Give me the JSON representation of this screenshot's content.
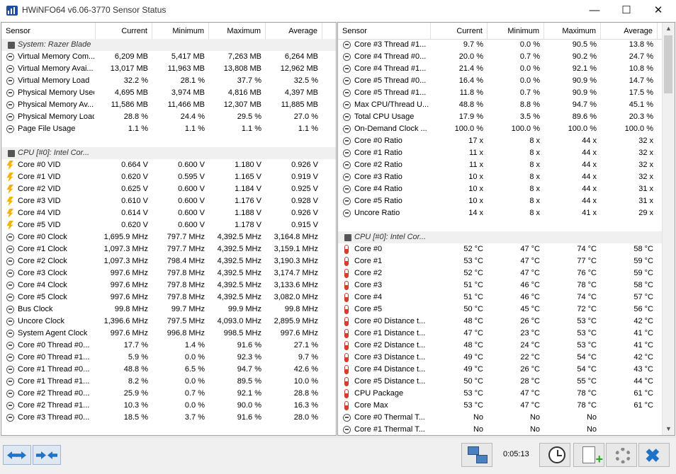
{
  "window": {
    "title": "HWiNFO64 v6.06-3770 Sensor Status",
    "minimize_icon": "minimize-icon",
    "maximize_icon": "maximize-icon",
    "close_icon": "close-icon"
  },
  "columns": [
    "Sensor",
    "Current",
    "Minimum",
    "Maximum",
    "Average"
  ],
  "left_rows": [
    {
      "type": "group",
      "icon": "chip-icon",
      "name": "System: Razer Blade"
    },
    {
      "type": "sensor",
      "icon": "gauge-icon",
      "name": "Virtual Memory Com...",
      "cur": "6,209 MB",
      "min": "5,417 MB",
      "max": "7,263 MB",
      "avg": "6,264 MB"
    },
    {
      "type": "sensor",
      "icon": "gauge-icon",
      "name": "Virtual Memory Avai...",
      "cur": "13,017 MB",
      "min": "11,963 MB",
      "max": "13,808 MB",
      "avg": "12,962 MB"
    },
    {
      "type": "sensor",
      "icon": "gauge-icon",
      "name": "Virtual Memory Load",
      "cur": "32.2 %",
      "min": "28.1 %",
      "max": "37.7 %",
      "avg": "32.5 %"
    },
    {
      "type": "sensor",
      "icon": "gauge-icon",
      "name": "Physical Memory Used",
      "cur": "4,695 MB",
      "min": "3,974 MB",
      "max": "4,816 MB",
      "avg": "4,397 MB"
    },
    {
      "type": "sensor",
      "icon": "gauge-icon",
      "name": "Physical Memory Av...",
      "cur": "11,586 MB",
      "min": "11,466 MB",
      "max": "12,307 MB",
      "avg": "11,885 MB"
    },
    {
      "type": "sensor",
      "icon": "gauge-icon",
      "name": "Physical Memory Load",
      "cur": "28.8 %",
      "min": "24.4 %",
      "max": "29.5 %",
      "avg": "27.0 %"
    },
    {
      "type": "sensor",
      "icon": "gauge-icon",
      "name": "Page File Usage",
      "cur": "1.1 %",
      "min": "1.1 %",
      "max": "1.1 %",
      "avg": "1.1 %"
    },
    {
      "type": "spacer"
    },
    {
      "type": "group",
      "icon": "chip-icon",
      "name": "CPU [#0]: Intel Cor..."
    },
    {
      "type": "sensor",
      "icon": "voltage-icon",
      "name": "Core #0 VID",
      "cur": "0.664 V",
      "min": "0.600 V",
      "max": "1.180 V",
      "avg": "0.926 V"
    },
    {
      "type": "sensor",
      "icon": "voltage-icon",
      "name": "Core #1 VID",
      "cur": "0.620 V",
      "min": "0.595 V",
      "max": "1.165 V",
      "avg": "0.919 V"
    },
    {
      "type": "sensor",
      "icon": "voltage-icon",
      "name": "Core #2 VID",
      "cur": "0.625 V",
      "min": "0.600 V",
      "max": "1.184 V",
      "avg": "0.925 V"
    },
    {
      "type": "sensor",
      "icon": "voltage-icon",
      "name": "Core #3 VID",
      "cur": "0.610 V",
      "min": "0.600 V",
      "max": "1.176 V",
      "avg": "0.928 V"
    },
    {
      "type": "sensor",
      "icon": "voltage-icon",
      "name": "Core #4 VID",
      "cur": "0.614 V",
      "min": "0.600 V",
      "max": "1.188 V",
      "avg": "0.926 V"
    },
    {
      "type": "sensor",
      "icon": "voltage-icon",
      "name": "Core #5 VID",
      "cur": "0.620 V",
      "min": "0.600 V",
      "max": "1.178 V",
      "avg": "0.915 V"
    },
    {
      "type": "sensor",
      "icon": "gauge-icon",
      "name": "Core #0 Clock",
      "cur": "1,695.9 MHz",
      "min": "797.7 MHz",
      "max": "4,392.5 MHz",
      "avg": "3,164.8 MHz"
    },
    {
      "type": "sensor",
      "icon": "gauge-icon",
      "name": "Core #1 Clock",
      "cur": "1,097.3 MHz",
      "min": "797.7 MHz",
      "max": "4,392.5 MHz",
      "avg": "3,159.1 MHz"
    },
    {
      "type": "sensor",
      "icon": "gauge-icon",
      "name": "Core #2 Clock",
      "cur": "1,097.3 MHz",
      "min": "798.4 MHz",
      "max": "4,392.5 MHz",
      "avg": "3,190.3 MHz"
    },
    {
      "type": "sensor",
      "icon": "gauge-icon",
      "name": "Core #3 Clock",
      "cur": "997.6 MHz",
      "min": "797.8 MHz",
      "max": "4,392.5 MHz",
      "avg": "3,174.7 MHz"
    },
    {
      "type": "sensor",
      "icon": "gauge-icon",
      "name": "Core #4 Clock",
      "cur": "997.6 MHz",
      "min": "797.8 MHz",
      "max": "4,392.5 MHz",
      "avg": "3,133.6 MHz"
    },
    {
      "type": "sensor",
      "icon": "gauge-icon",
      "name": "Core #5 Clock",
      "cur": "997.6 MHz",
      "min": "797.8 MHz",
      "max": "4,392.5 MHz",
      "avg": "3,082.0 MHz"
    },
    {
      "type": "sensor",
      "icon": "gauge-icon",
      "name": "Bus Clock",
      "cur": "99.8 MHz",
      "min": "99.7 MHz",
      "max": "99.9 MHz",
      "avg": "99.8 MHz"
    },
    {
      "type": "sensor",
      "icon": "gauge-icon",
      "name": "Uncore Clock",
      "cur": "1,396.6 MHz",
      "min": "797.5 MHz",
      "max": "4,093.0 MHz",
      "avg": "2,895.9 MHz"
    },
    {
      "type": "sensor",
      "icon": "gauge-icon",
      "name": "System Agent Clock",
      "cur": "997.6 MHz",
      "min": "996.8 MHz",
      "max": "998.5 MHz",
      "avg": "997.6 MHz"
    },
    {
      "type": "sensor",
      "icon": "gauge-icon",
      "name": "Core #0 Thread #0...",
      "cur": "17.7 %",
      "min": "1.4 %",
      "max": "91.6 %",
      "avg": "27.1 %"
    },
    {
      "type": "sensor",
      "icon": "gauge-icon",
      "name": "Core #0 Thread #1...",
      "cur": "5.9 %",
      "min": "0.0 %",
      "max": "92.3 %",
      "avg": "9.7 %"
    },
    {
      "type": "sensor",
      "icon": "gauge-icon",
      "name": "Core #1 Thread #0...",
      "cur": "48.8 %",
      "min": "6.5 %",
      "max": "94.7 %",
      "avg": "42.6 %"
    },
    {
      "type": "sensor",
      "icon": "gauge-icon",
      "name": "Core #1 Thread #1...",
      "cur": "8.2 %",
      "min": "0.0 %",
      "max": "89.5 %",
      "avg": "10.0 %"
    },
    {
      "type": "sensor",
      "icon": "gauge-icon",
      "name": "Core #2 Thread #0...",
      "cur": "25.9 %",
      "min": "0.7 %",
      "max": "92.1 %",
      "avg": "28.8 %"
    },
    {
      "type": "sensor",
      "icon": "gauge-icon",
      "name": "Core #2 Thread #1...",
      "cur": "10.3 %",
      "min": "0.0 %",
      "max": "90.0 %",
      "avg": "16.3 %"
    },
    {
      "type": "sensor",
      "icon": "gauge-icon",
      "name": "Core #3 Thread #0...",
      "cur": "18.5 %",
      "min": "3.7 %",
      "max": "91.6 %",
      "avg": "28.0 %"
    }
  ],
  "right_rows": [
    {
      "type": "sensor",
      "icon": "gauge-icon",
      "name": "Core #3 Thread #1...",
      "cur": "9.7 %",
      "min": "0.0 %",
      "max": "90.5 %",
      "avg": "13.8 %"
    },
    {
      "type": "sensor",
      "icon": "gauge-icon",
      "name": "Core #4 Thread #0...",
      "cur": "20.0 %",
      "min": "0.7 %",
      "max": "90.2 %",
      "avg": "24.7 %"
    },
    {
      "type": "sensor",
      "icon": "gauge-icon",
      "name": "Core #4 Thread #1...",
      "cur": "21.4 %",
      "min": "0.0 %",
      "max": "92.1 %",
      "avg": "10.8 %"
    },
    {
      "type": "sensor",
      "icon": "gauge-icon",
      "name": "Core #5 Thread #0...",
      "cur": "16.4 %",
      "min": "0.0 %",
      "max": "90.9 %",
      "avg": "14.7 %"
    },
    {
      "type": "sensor",
      "icon": "gauge-icon",
      "name": "Core #5 Thread #1...",
      "cur": "11.8 %",
      "min": "0.7 %",
      "max": "90.9 %",
      "avg": "17.5 %"
    },
    {
      "type": "sensor",
      "icon": "gauge-icon",
      "name": "Max CPU/Thread U...",
      "cur": "48.8 %",
      "min": "8.8 %",
      "max": "94.7 %",
      "avg": "45.1 %"
    },
    {
      "type": "sensor",
      "icon": "gauge-icon",
      "name": "Total CPU Usage",
      "cur": "17.9 %",
      "min": "3.5 %",
      "max": "89.6 %",
      "avg": "20.3 %"
    },
    {
      "type": "sensor",
      "icon": "gauge-icon",
      "name": "On-Demand Clock ...",
      "cur": "100.0 %",
      "min": "100.0 %",
      "max": "100.0 %",
      "avg": "100.0 %"
    },
    {
      "type": "sensor",
      "icon": "gauge-icon",
      "name": "Core #0 Ratio",
      "cur": "17 x",
      "min": "8 x",
      "max": "44 x",
      "avg": "32 x"
    },
    {
      "type": "sensor",
      "icon": "gauge-icon",
      "name": "Core #1 Ratio",
      "cur": "11 x",
      "min": "8 x",
      "max": "44 x",
      "avg": "32 x"
    },
    {
      "type": "sensor",
      "icon": "gauge-icon",
      "name": "Core #2 Ratio",
      "cur": "11 x",
      "min": "8 x",
      "max": "44 x",
      "avg": "32 x"
    },
    {
      "type": "sensor",
      "icon": "gauge-icon",
      "name": "Core #3 Ratio",
      "cur": "10 x",
      "min": "8 x",
      "max": "44 x",
      "avg": "32 x"
    },
    {
      "type": "sensor",
      "icon": "gauge-icon",
      "name": "Core #4 Ratio",
      "cur": "10 x",
      "min": "8 x",
      "max": "44 x",
      "avg": "31 x"
    },
    {
      "type": "sensor",
      "icon": "gauge-icon",
      "name": "Core #5 Ratio",
      "cur": "10 x",
      "min": "8 x",
      "max": "44 x",
      "avg": "31 x"
    },
    {
      "type": "sensor",
      "icon": "gauge-icon",
      "name": "Uncore Ratio",
      "cur": "14 x",
      "min": "8 x",
      "max": "41 x",
      "avg": "29 x"
    },
    {
      "type": "spacer"
    },
    {
      "type": "group",
      "icon": "chip-icon",
      "name": "CPU [#0]: Intel Cor..."
    },
    {
      "type": "sensor",
      "icon": "thermometer-icon",
      "name": "Core #0",
      "cur": "52 °C",
      "min": "47 °C",
      "max": "74 °C",
      "avg": "58 °C"
    },
    {
      "type": "sensor",
      "icon": "thermometer-icon",
      "name": "Core #1",
      "cur": "53 °C",
      "min": "47 °C",
      "max": "77 °C",
      "avg": "59 °C"
    },
    {
      "type": "sensor",
      "icon": "thermometer-icon",
      "name": "Core #2",
      "cur": "52 °C",
      "min": "47 °C",
      "max": "76 °C",
      "avg": "59 °C"
    },
    {
      "type": "sensor",
      "icon": "thermometer-icon",
      "name": "Core #3",
      "cur": "51 °C",
      "min": "46 °C",
      "max": "78 °C",
      "avg": "58 °C"
    },
    {
      "type": "sensor",
      "icon": "thermometer-icon",
      "name": "Core #4",
      "cur": "51 °C",
      "min": "46 °C",
      "max": "74 °C",
      "avg": "57 °C"
    },
    {
      "type": "sensor",
      "icon": "thermometer-icon",
      "name": "Core #5",
      "cur": "50 °C",
      "min": "45 °C",
      "max": "72 °C",
      "avg": "56 °C"
    },
    {
      "type": "sensor",
      "icon": "thermometer-icon",
      "name": "Core #0 Distance t...",
      "cur": "48 °C",
      "min": "26 °C",
      "max": "53 °C",
      "avg": "42 °C"
    },
    {
      "type": "sensor",
      "icon": "thermometer-icon",
      "name": "Core #1 Distance t...",
      "cur": "47 °C",
      "min": "23 °C",
      "max": "53 °C",
      "avg": "41 °C"
    },
    {
      "type": "sensor",
      "icon": "thermometer-icon",
      "name": "Core #2 Distance t...",
      "cur": "48 °C",
      "min": "24 °C",
      "max": "53 °C",
      "avg": "41 °C"
    },
    {
      "type": "sensor",
      "icon": "thermometer-icon",
      "name": "Core #3 Distance t...",
      "cur": "49 °C",
      "min": "22 °C",
      "max": "54 °C",
      "avg": "42 °C"
    },
    {
      "type": "sensor",
      "icon": "thermometer-icon",
      "name": "Core #4 Distance t...",
      "cur": "49 °C",
      "min": "26 °C",
      "max": "54 °C",
      "avg": "43 °C"
    },
    {
      "type": "sensor",
      "icon": "thermometer-icon",
      "name": "Core #5 Distance t...",
      "cur": "50 °C",
      "min": "28 °C",
      "max": "55 °C",
      "avg": "44 °C"
    },
    {
      "type": "sensor",
      "icon": "thermometer-icon",
      "name": "CPU Package",
      "cur": "53 °C",
      "min": "47 °C",
      "max": "78 °C",
      "avg": "61 °C"
    },
    {
      "type": "sensor",
      "icon": "thermometer-icon",
      "name": "Core Max",
      "cur": "53 °C",
      "min": "47 °C",
      "max": "78 °C",
      "avg": "61 °C"
    },
    {
      "type": "sensor",
      "icon": "gauge-icon",
      "name": "Core #0 Thermal T...",
      "cur": "No",
      "min": "No",
      "max": "No",
      "avg": ""
    },
    {
      "type": "sensor",
      "icon": "gauge-icon",
      "name": "Core #1 Thermal T...",
      "cur": "No",
      "min": "No",
      "max": "No",
      "avg": ""
    }
  ],
  "toolbar": {
    "timer": "0:05:13",
    "nav_left_icon": "arrows-left-right-icon",
    "nav_right_icon": "arrows-collapse-icon",
    "network_icon": "network-icon",
    "clock_icon": "clock-icon",
    "report_icon": "add-report-icon",
    "settings_icon": "gear-icon",
    "close_icon": "close-x-icon"
  },
  "colors": {
    "accent": "#1e73c8",
    "voltage": "#f2b400",
    "temperature": "#e03a2a",
    "group_row": "#f0f0f0"
  }
}
